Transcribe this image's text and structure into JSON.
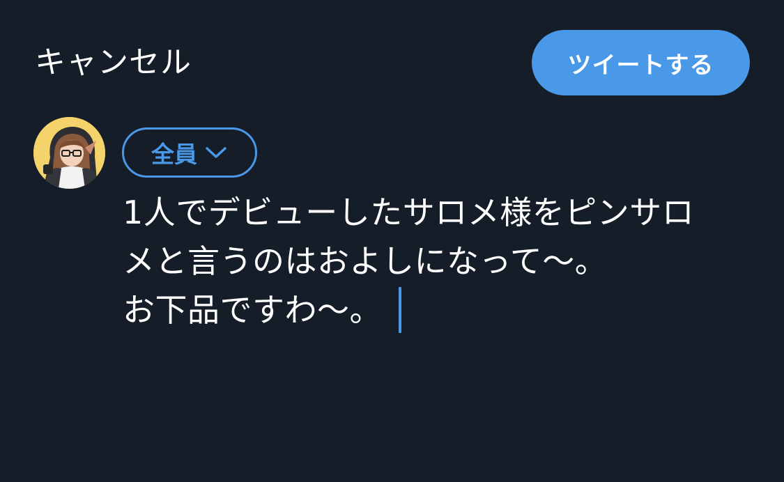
{
  "header": {
    "cancel_label": "キャンセル",
    "tweet_label": "ツイートする"
  },
  "composer": {
    "audience_label": "全員",
    "audience_icon": "chevron-down-icon",
    "avatar_icon": "user-avatar",
    "text_lines": [
      "1人でデビューしたサロメ様をピンサロ",
      "メと言うのはおよしになって〜。",
      "お下品ですわ〜。"
    ]
  },
  "colors": {
    "background": "#151d29",
    "accent": "#4a99e9",
    "text": "#ffffff"
  }
}
